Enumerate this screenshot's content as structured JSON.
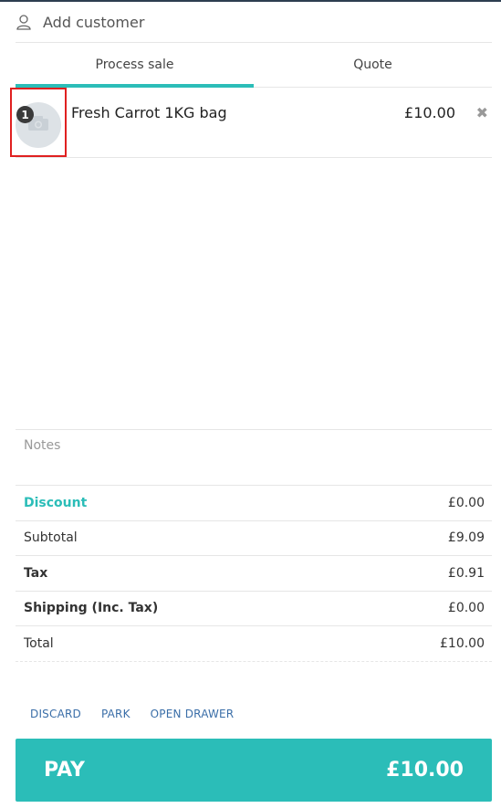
{
  "customer": {
    "label": "Add customer",
    "icon": "user-icon"
  },
  "tabs": [
    {
      "label": "Process sale",
      "active": true
    },
    {
      "label": "Quote",
      "active": false
    }
  ],
  "items": [
    {
      "quantity": "1",
      "name": "Fresh Carrot 1KG bag",
      "price": "£10.00",
      "remove": "✖",
      "image_icon": "camera-icon"
    }
  ],
  "notes": {
    "placeholder": "Notes"
  },
  "summary": {
    "discount": {
      "label": "Discount",
      "value": "£0.00"
    },
    "subtotal": {
      "label": "Subtotal",
      "value": "£9.09"
    },
    "tax": {
      "label": "Tax",
      "value": "£0.91"
    },
    "shipping": {
      "label": "Shipping (Inc. Tax)",
      "value": "£0.00"
    },
    "total": {
      "label": "Total",
      "value": "£10.00"
    }
  },
  "actions": {
    "discard": "DISCARD",
    "park": "PARK",
    "open_drawer": "OPEN DRAWER"
  },
  "pay": {
    "label": "PAY",
    "amount": "£10.00"
  },
  "colors": {
    "accent": "#2bbdb8",
    "link": "#3a6ea8",
    "highlight": "#e02020"
  }
}
